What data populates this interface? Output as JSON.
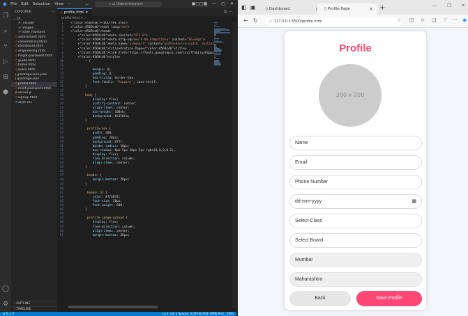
{
  "vscode": {
    "menu": [
      "File",
      "Edit",
      "Selection",
      "View",
      "···"
    ],
    "search_text": "ui [Administrator]",
    "explorer_label": "EXPLORER",
    "root_folder": "UI",
    "files": [
      {
        "name": "> .vscode",
        "icon": "folder"
      },
      {
        "name": "> images",
        "icon": "folder"
      },
      {
        "name": "> node_modules",
        "icon": "folder"
      },
      {
        "name": "assessment.html",
        "icon": "html"
      },
      {
        "name": "careerlibrary.html",
        "icon": "html"
      },
      {
        "name": "dashboard.html",
        "icon": "html"
      },
      {
        "name": "engineering.html",
        "icon": "html"
      },
      {
        "name": "forgot-password.html",
        "icon": "html"
      },
      {
        "name": "guide.html",
        "icon": "html"
      },
      {
        "name": "home.html",
        "icon": "html"
      },
      {
        "name": "index.html",
        "icon": "html"
      },
      {
        "name": "package-lock.json",
        "icon": "json"
      },
      {
        "name": "package.json",
        "icon": "json"
      },
      {
        "name": "profile.html",
        "icon": "html",
        "selected": true
      },
      {
        "name": "reset-password.html",
        "icon": "html"
      },
      {
        "name": "server.js",
        "icon": "js"
      },
      {
        "name": "signup.html",
        "icon": "html"
      },
      {
        "name": "style.css",
        "icon": "css"
      }
    ],
    "outline_label": "OUTLINE",
    "timeline_label": "TIMELINE",
    "tab_label": "profile.html",
    "breadcrumb": "profile.html > ...",
    "code_lines": [
      "<!DOCTYPE html>",
      "<html lang=\"en\">",
      "<head>",
      "    <meta charset=\"UTF-8\">",
      "    <meta http-equiv=\"X-UA-Compatible\" content=\"IE=edge\">",
      "    <meta name=\"viewport\" content=\"width=device-width, initial-scale=1.0\">",
      "    <title>Profile Page</title>",
      "    <link href=\"https://fonts.googleapis.com/css2?family=Poppins:wght@400;500",
      "    <style>",
      "        * {",
      "",
      "            margin: 0;",
      "            padding: 0;",
      "            box-sizing: border-box;",
      "            font-family: 'Poppins', sans-serif;",
      "        }",
      "",
      "        body {",
      "            display: flex;",
      "            justify-content: center;",
      "            align-items: center;",
      "            min-height: 100vh;",
      "            background: #e1f0fa;",
      "        }",
      "",
      "        .profile-box {",
      "            width: 400;",
      "            padding: 20px;",
      "            background: #fff;",
      "            border-radius: 10px;",
      "            box-shadow: 0px 5px 10px 5px rgba(0,0,0,0.2);",
      "            display: flex;",
      "            flex-direction: column;",
      "            align-items: center;",
      "        }",
      "",
      "        .header {",
      "            margin-bottom: 20px;",
      "        }",
      "",
      "        .header h1 {",
      "            color: #ff4874;",
      "            font-size: 28px;",
      "            font-weight: 600;",
      "        }",
      "",
      "        .profile-image-upload {",
      "            display: flex;",
      "            flex-direction: column;",
      "            align-items: center;",
      "            margin-bottom: 20px;"
    ],
    "status_left": "⊗ 0 ⚠ 0",
    "status_right": "Ln 1, Col 1   Spaces: 4   UTF-8   CRLF   HTML   Port : 5500"
  },
  "browser": {
    "tabs": [
      {
        "label": "Dashboard",
        "active": false
      },
      {
        "label": "Profile Page",
        "active": true
      }
    ],
    "url": "127.0.0.1:5500/profile.html"
  },
  "profile": {
    "title": "Profile",
    "avatar_placeholder": "200 x 200",
    "fields": [
      {
        "key": "name",
        "text": "Name",
        "readonly": false
      },
      {
        "key": "email",
        "text": "Email",
        "readonly": false
      },
      {
        "key": "phone",
        "text": "Phone Number",
        "readonly": false
      },
      {
        "key": "dob",
        "text": "dd-mm-yyyy",
        "readonly": false,
        "calendar": true
      },
      {
        "key": "class",
        "text": "Select Class",
        "readonly": false
      },
      {
        "key": "board",
        "text": "Select Board",
        "readonly": false
      },
      {
        "key": "city",
        "text": "Mumbai",
        "readonly": true
      },
      {
        "key": "state",
        "text": "Maharashtra",
        "readonly": true
      }
    ],
    "back_label": "Back",
    "save_label": "Save Profile"
  },
  "colors": {
    "accent": "#ff4874",
    "vscode_status": "#007acc"
  }
}
